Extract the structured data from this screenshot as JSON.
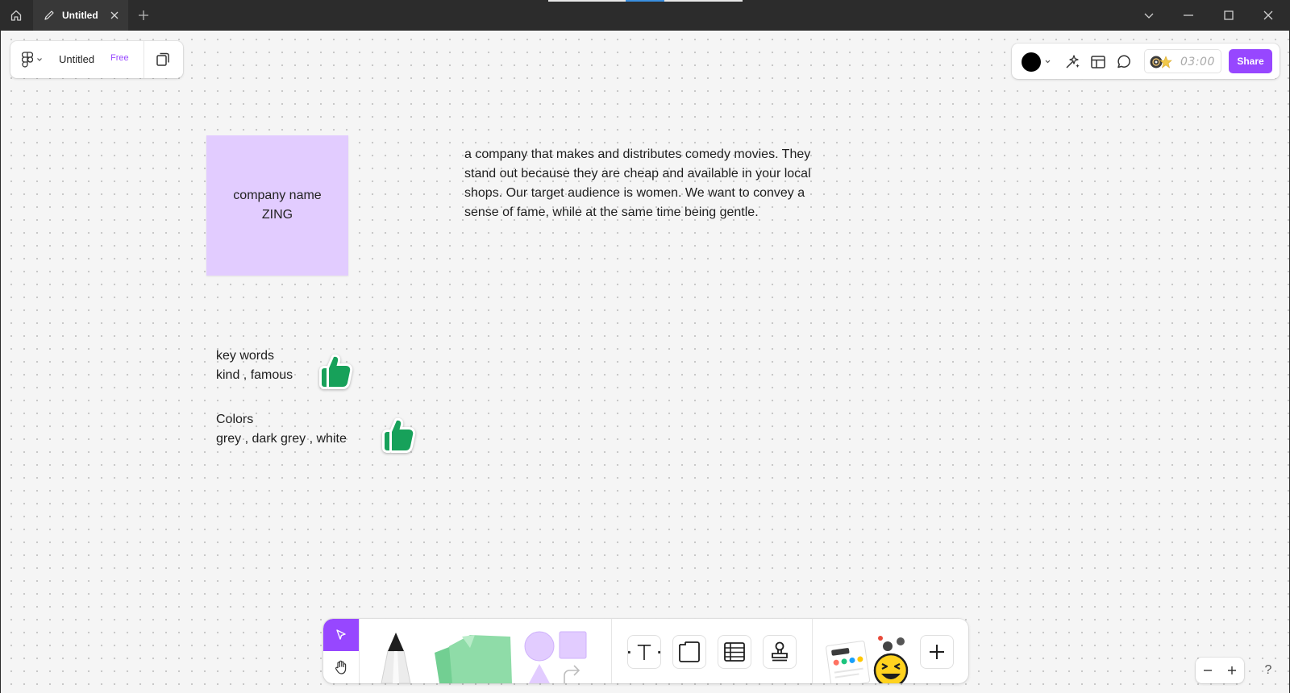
{
  "titlebar": {
    "tab_title": "Untitled",
    "progress_fraction": 0.2
  },
  "file_panel": {
    "file_name": "Untitled",
    "plan_badge": "Free"
  },
  "right_panel": {
    "current_color": "#000000",
    "timer": "03:00",
    "share_label": "Share",
    "accent_color": "#9747ff"
  },
  "board": {
    "sticky": {
      "line1": "company name",
      "line2": "ZING",
      "color": "#e2ccff"
    },
    "description": "a company that makes and distributes comedy movies. They stand out because they are cheap and available in your local shops. Our target audience is women. We want to convey a sense of fame, while at the same time being gentle.",
    "keywords": {
      "heading": "key words",
      "values": "kind , famous",
      "sticker": "thumbs-up-icon"
    },
    "colors": {
      "heading": "Colors",
      "values": "grey ,  dark grey , white",
      "sticker": "thumbs-up-icon"
    }
  },
  "toolbar": {
    "tools": [
      "move",
      "hand",
      "marker",
      "sticky-note",
      "shapes",
      "connector",
      "text",
      "section",
      "table",
      "stamp",
      "widgets",
      "more"
    ]
  },
  "help": "?"
}
